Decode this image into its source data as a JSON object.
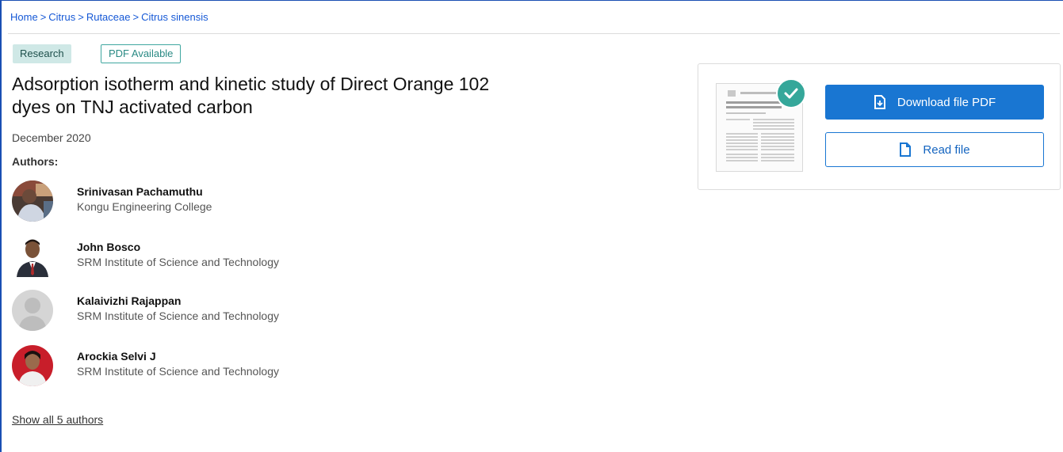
{
  "breadcrumb": {
    "items": [
      "Home",
      "Citrus",
      "Rutaceae",
      "Citrus sinensis"
    ],
    "separator": ">"
  },
  "badges": {
    "research": "Research",
    "pdf_available": "PDF Available"
  },
  "paper": {
    "title_line1": "Adsorption isotherm and kinetic study of Direct Orange 102",
    "title_line2": "dyes on TNJ activated carbon",
    "date": "December 2020",
    "authors_label": "Authors:"
  },
  "authors": [
    {
      "name": "Srinivasan Pachamuthu",
      "institution": "Kongu Engineering College"
    },
    {
      "name": "John Bosco",
      "institution": "SRM Institute of Science and Technology"
    },
    {
      "name": "Kalaivizhi Rajappan",
      "institution": "SRM Institute of Science and Technology"
    },
    {
      "name": "Arockia Selvi J",
      "institution": "SRM Institute of Science and Technology"
    }
  ],
  "show_all": "Show all 5 authors",
  "actions": {
    "download_label": "Download file PDF",
    "read_label": "Read file"
  },
  "colors": {
    "link": "#1558d6",
    "primary": "#1976d2",
    "teal": "#35a79a"
  }
}
